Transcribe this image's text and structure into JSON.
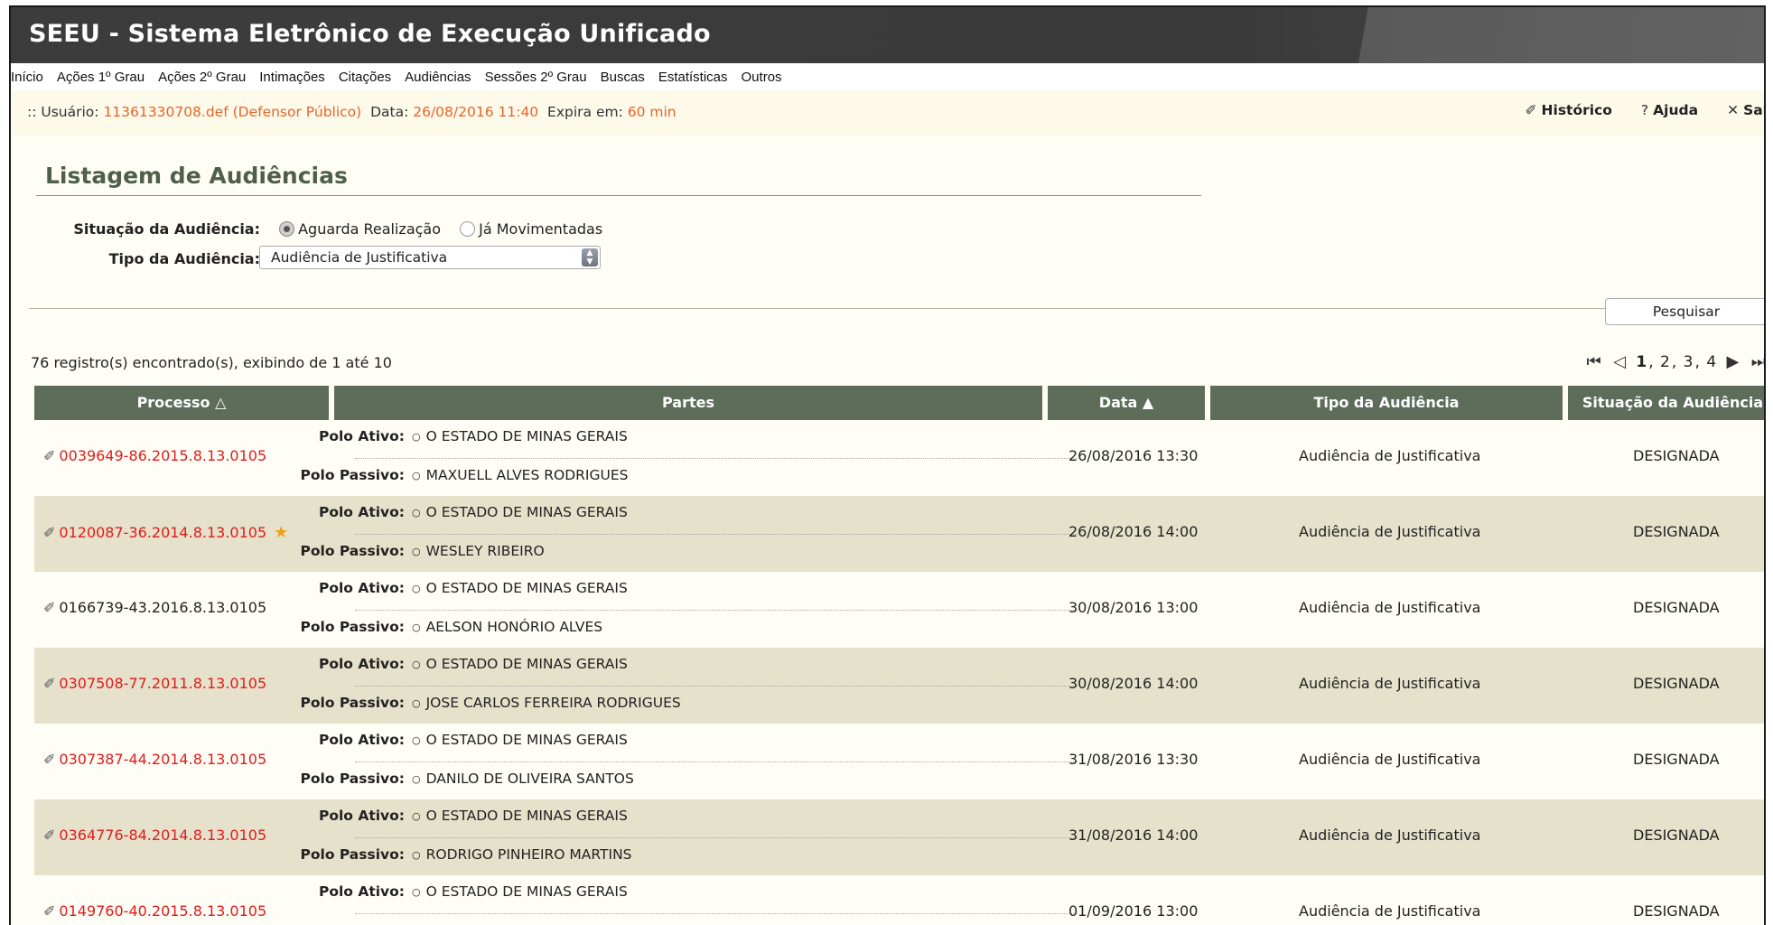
{
  "app_title": "SEEU - Sistema Eletrônico de Execução Unificado",
  "menu": [
    "Início",
    "Ações 1º Grau",
    "Ações 2º Grau",
    "Intimações",
    "Citações",
    "Audiências",
    "Sessões 2º Grau",
    "Buscas",
    "Estatísticas",
    "Outros"
  ],
  "userbar": {
    "prefix": ":: Usuário:",
    "user": "11361330708.def (Defensor Público)",
    "data_label": "Data:",
    "data_value": "26/08/2016 11:40",
    "expira_label": "Expira em:",
    "expira_value": "60 min",
    "actions": {
      "historico": "Histórico",
      "ajuda": "Ajuda",
      "sair": "Sai"
    }
  },
  "page_title": "Listagem de Audiências",
  "filters": {
    "situacao_label": "Situação da Audiência:",
    "situacao_options": [
      "Aguarda Realização",
      "Já Movimentadas"
    ],
    "situacao_selected": "Aguarda Realização",
    "tipo_label": "Tipo da Audiência:",
    "tipo_value": "Audiência de Justificativa"
  },
  "search_button": "Pesquisar",
  "records_text": "76 registro(s) encontrado(s), exibindo de 1 até 10",
  "pagination": {
    "current": "1",
    "pages": [
      "2",
      "3",
      "4"
    ]
  },
  "table": {
    "headers": {
      "processo": "Processo",
      "partes": "Partes",
      "data": "Data",
      "tipo": "Tipo da Audiência",
      "situacao": "Situação da Audiência"
    },
    "polo_ativo_label": "Polo Ativo:",
    "polo_passivo_label": "Polo Passivo:",
    "rows": [
      {
        "processo": "0039649-86.2015.8.13.0105",
        "ativo": "O ESTADO DE MINAS GERAIS",
        "passivo": "MAXUELL ALVES RODRIGUES",
        "data": "26/08/2016 13:30",
        "tipo": "Audiência de Justificativa",
        "situacao": "DESIGNADA"
      },
      {
        "processo": "0120087-36.2014.8.13.0105",
        "ativo": "O ESTADO DE MINAS GERAIS",
        "passivo": "WESLEY RIBEIRO",
        "data": "26/08/2016 14:00",
        "tipo": "Audiência de Justificativa",
        "situacao": "DESIGNADA"
      },
      {
        "processo": "0166739-43.2016.8.13.0105",
        "ativo": "O ESTADO DE MINAS GERAIS",
        "passivo": "AELSON HONÓRIO ALVES",
        "data": "30/08/2016 13:00",
        "tipo": "Audiência de Justificativa",
        "situacao": "DESIGNADA"
      },
      {
        "processo": "0307508-77.2011.8.13.0105",
        "ativo": "O ESTADO DE MINAS GERAIS",
        "passivo": "JOSE CARLOS FERREIRA RODRIGUES",
        "data": "30/08/2016 14:00",
        "tipo": "Audiência de Justificativa",
        "situacao": "DESIGNADA"
      },
      {
        "processo": "0307387-44.2014.8.13.0105",
        "ativo": "O ESTADO DE MINAS GERAIS",
        "passivo": "DANILO DE OLIVEIRA SANTOS",
        "data": "31/08/2016 13:30",
        "tipo": "Audiência de Justificativa",
        "situacao": "DESIGNADA"
      },
      {
        "processo": "0364776-84.2014.8.13.0105",
        "ativo": "O ESTADO DE MINAS GERAIS",
        "passivo": "RODRIGO PINHEIRO MARTINS",
        "data": "31/08/2016 14:00",
        "tipo": "Audiência de Justificativa",
        "situacao": "DESIGNADA"
      },
      {
        "processo": "0149760-40.2015.8.13.0105",
        "ativo": "O ESTADO DE MINAS GERAIS",
        "passivo": "",
        "data": "01/09/2016 13:00",
        "tipo": "Audiência de Justificativa",
        "situacao": "DESIGNADA"
      }
    ]
  },
  "colors": {
    "header_bg": "#5e6d5a",
    "alt_row": "#e5e1cb",
    "link_red": "#e01b1b",
    "accent_orange": "#e8632a",
    "title_green": "#4f5f4c"
  }
}
